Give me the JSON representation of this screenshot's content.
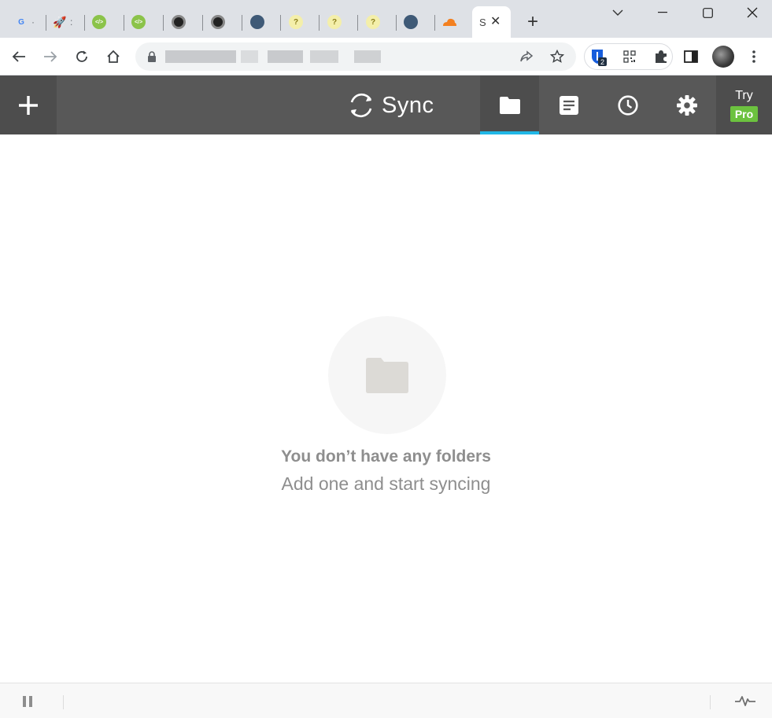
{
  "browser": {
    "tabs": [
      {
        "icon": "google-icon",
        "fragment": "·",
        "color": "#4285f4"
      },
      {
        "icon": "rocket-icon",
        "fragment": ":",
        "color": "#e0602e"
      },
      {
        "icon": "code-icon",
        "fragment": "",
        "color": "#8bc34a"
      },
      {
        "icon": "code-icon",
        "fragment": "",
        "color": "#8bc34a"
      },
      {
        "icon": "circle-logo-icon",
        "fragment": "",
        "color": "#222222"
      },
      {
        "icon": "circle-logo-icon",
        "fragment": "",
        "color": "#222222"
      },
      {
        "icon": "docker-icon",
        "fragment": "",
        "color": "#3f5a77"
      },
      {
        "icon": "question-icon",
        "fragment": "",
        "color": "#e8e07a"
      },
      {
        "icon": "question-icon",
        "fragment": "",
        "color": "#e8e07a"
      },
      {
        "icon": "question-icon",
        "fragment": "",
        "color": "#e8e07a"
      },
      {
        "icon": "docker-icon",
        "fragment": "",
        "color": "#3f5a77"
      },
      {
        "icon": "cloudflare-icon",
        "fragment": "",
        "color": "#f38020"
      }
    ],
    "active_tab_fragment": "S",
    "extension_badge": "2"
  },
  "app": {
    "logo_text": "Sync",
    "nav": [
      {
        "icon": "folder-icon",
        "active": true
      },
      {
        "icon": "document-icon",
        "active": false
      },
      {
        "icon": "clock-icon",
        "active": false
      },
      {
        "icon": "gear-icon",
        "active": false
      }
    ],
    "try_label": "Try",
    "pro_label": "Pro",
    "accent_color": "#21b7e6",
    "pro_color": "#6cc23f"
  },
  "empty_state": {
    "title": "You don’t have any folders",
    "subtitle": "Add one and start syncing"
  }
}
